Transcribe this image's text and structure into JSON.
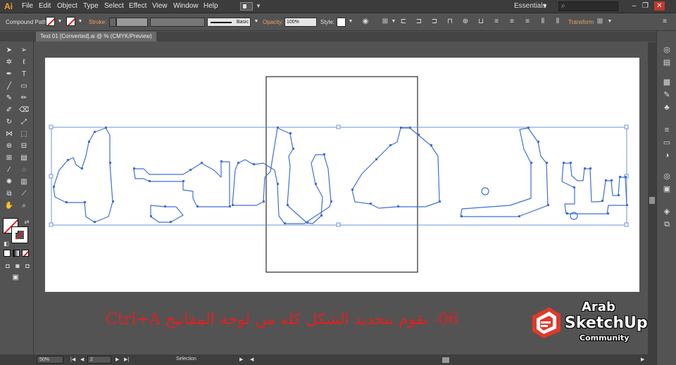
{
  "app": {
    "logo": "Ai",
    "menu": [
      "File",
      "Edit",
      "Object",
      "Type",
      "Select",
      "Effect",
      "View",
      "Window",
      "Help"
    ],
    "workspace": "Essentials",
    "accent": "#f0a030"
  },
  "control": {
    "selection_type": "Compound Path",
    "stroke_label": "Stroke:",
    "brush_label": "Basic",
    "opacity_label": "Opacity:",
    "opacity_value": "100%",
    "style_label": "Style:",
    "transform_label": "Transform"
  },
  "document": {
    "tab_title": "Text 01 [Converted].ai @ % (CMYK/Preview)"
  },
  "status": {
    "zoom": "50%",
    "artboard_number": "2",
    "tool_name": "Selection"
  },
  "caption": {
    "text": "06- نقوم بتحديد الشكل كله من لوحة المفاتيح Ctrl+A",
    "color": "#e02020"
  },
  "logo": {
    "line1": "Arab",
    "line2": "SketchUp",
    "line3": "Community",
    "brand_color": "#e03a2a"
  },
  "icons": {
    "search": "search-icon",
    "minimize": "minimize-icon",
    "restore": "restore-icon",
    "close": "close-icon"
  }
}
